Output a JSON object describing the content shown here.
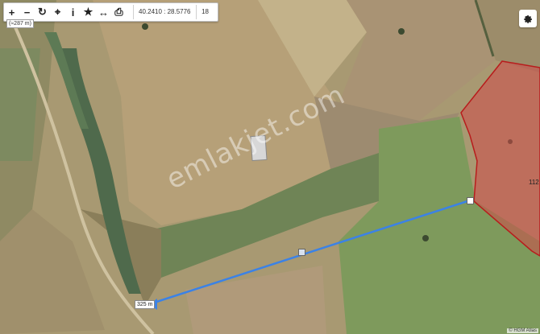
{
  "toolbar": {
    "buttons": [
      {
        "name": "zoom-in-button",
        "glyph": "+"
      },
      {
        "name": "zoom-out-button",
        "glyph": "−"
      },
      {
        "name": "refresh-button",
        "glyph": "↻"
      },
      {
        "name": "locate-button",
        "glyph": "⌖"
      },
      {
        "name": "info-button",
        "glyph": "i"
      },
      {
        "name": "favorite-button",
        "glyph": "★"
      },
      {
        "name": "measure-button",
        "glyph": "↔"
      },
      {
        "name": "print-button",
        "glyph": "⎙"
      }
    ],
    "coordinates": "40.2410 : 28.5776",
    "zoom_level": "18"
  },
  "scale_badge": "(≈287 m)",
  "measurement": {
    "distance_label": "325 m",
    "line_color": "#3b82e6"
  },
  "parcel": {
    "label": "112",
    "fill_color": "#d04a4a",
    "stroke_color": "#b81c1c"
  },
  "watermark": "emlakjet.com",
  "attribution": "© HGM Atlas",
  "icons": {
    "settings": "gear-icon"
  }
}
